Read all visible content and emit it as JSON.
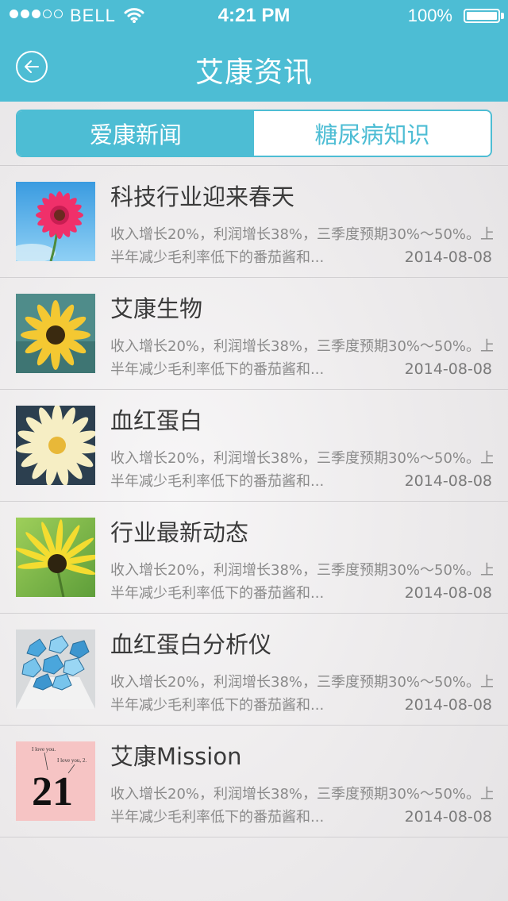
{
  "status_bar": {
    "carrier": "BELL",
    "time": "4:21 PM",
    "battery": "100%"
  },
  "nav": {
    "title": "艾康资讯",
    "back_icon": "back-arrow-icon"
  },
  "tabs": [
    {
      "label": "爱康新闻",
      "active": true
    },
    {
      "label": "糖尿病知识",
      "active": false
    }
  ],
  "colors": {
    "accent": "#4dbdd4",
    "title_text": "#3a3a3a",
    "summary_text": "#8a8a8a"
  },
  "items": [
    {
      "title": "科技行业迎来春天",
      "summary_line1": "收入增长20%，利润增长38%，三季度预期30%～50%。上",
      "summary_line2": "半年减少毛利率低下的番茄酱和...",
      "date": "2014-08-08",
      "image": "pink-gerbera-flower"
    },
    {
      "title": "艾康生物",
      "summary_line1": "收入增长20%，利润增长38%，三季度预期30%～50%。上",
      "summary_line2": "半年减少毛利率低下的番茄酱和...",
      "date": "2014-08-08",
      "image": "yellow-daisy-flower"
    },
    {
      "title": "血红蛋白",
      "summary_line1": "收入增长20%，利润增长38%，三季度预期30%～50%。上",
      "summary_line2": "半年减少毛利率低下的番茄酱和...",
      "date": "2014-08-08",
      "image": "white-daisy-flower"
    },
    {
      "title": "行业最新动态",
      "summary_line1": "收入增长20%，利润增长38%，三季度预期30%～50%。上",
      "summary_line2": "半年减少毛利率低下的番茄酱和...",
      "date": "2014-08-08",
      "image": "yellow-sunflower"
    },
    {
      "title": "血红蛋白分析仪",
      "summary_line1": "收入增长20%，利润增长38%，三季度预期30%～50%。上",
      "summary_line2": "半年减少毛利率低下的番茄酱和...",
      "date": "2014-08-08",
      "image": "blue-paper-roses"
    },
    {
      "title": "艾康Mission",
      "summary_line1": "收入增长20%，利润增长38%，三季度预期30%～50%。上",
      "summary_line2": "半年减少毛利率低下的番茄酱和...",
      "date": "2014-08-08",
      "image": "calendar-note",
      "image_text": {
        "note1": "I love you.",
        "note2": "I love you, 2.",
        "day": "21"
      }
    }
  ]
}
